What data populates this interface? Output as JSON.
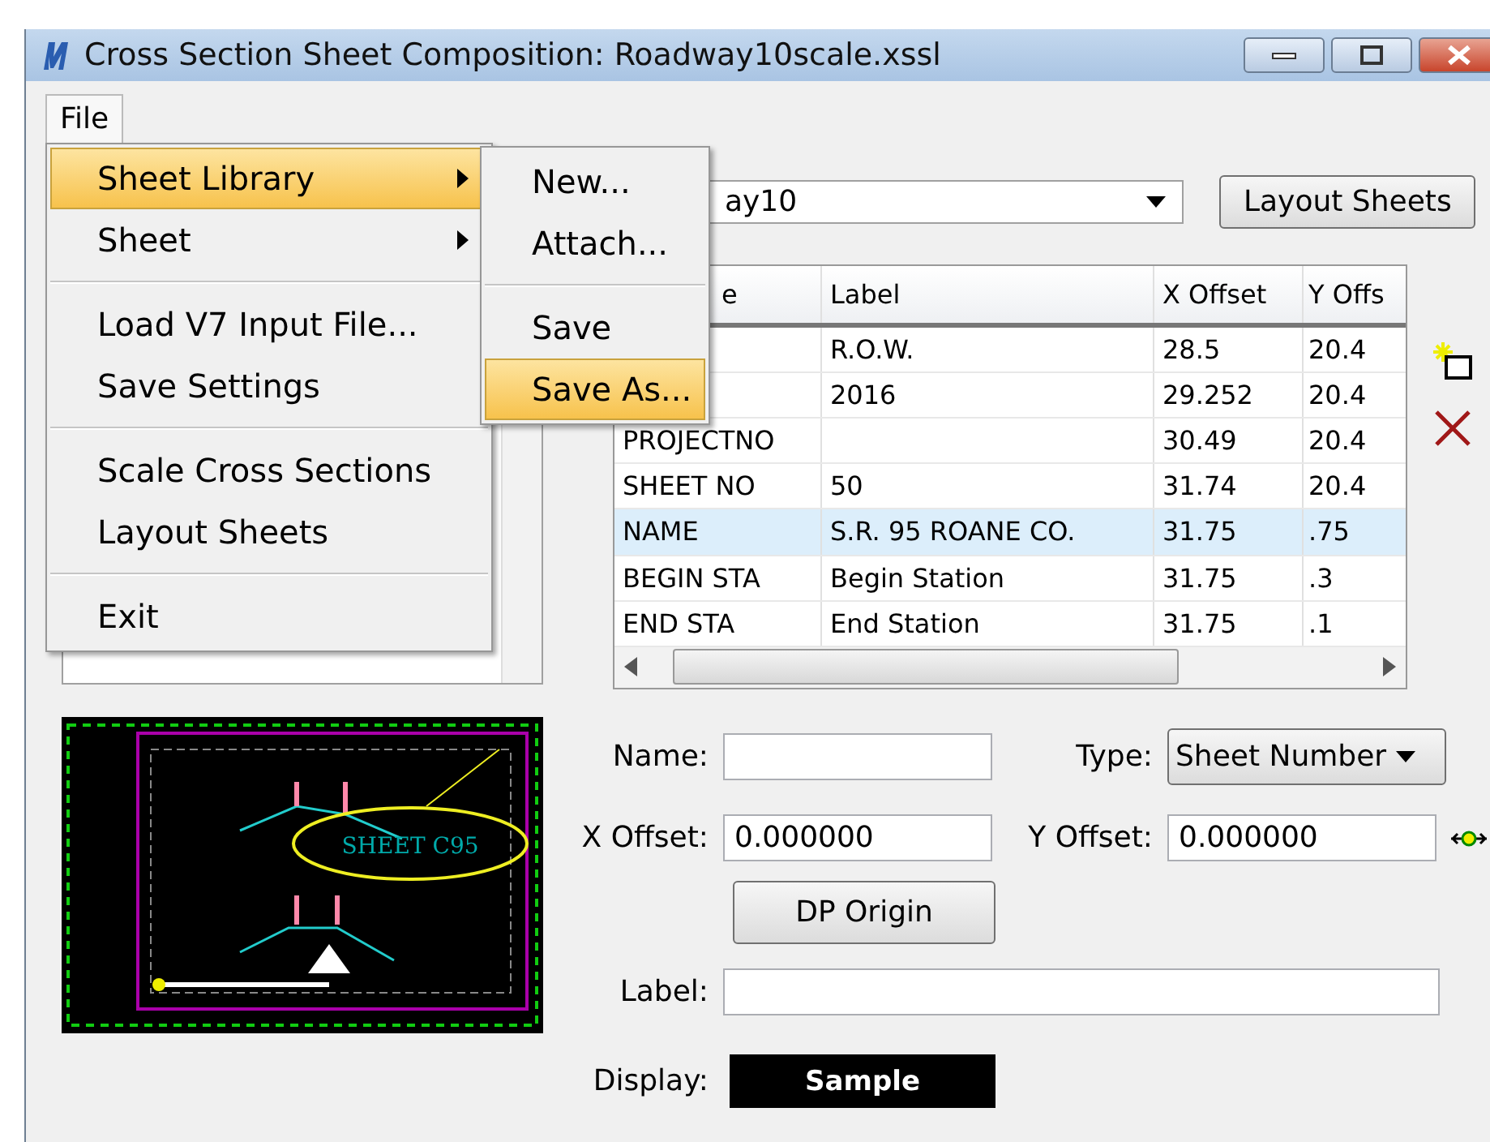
{
  "window": {
    "title": "Cross Section Sheet Composition: Roadway10scale.xssl"
  },
  "menu_bar": [
    {
      "label": "File",
      "open": true
    }
  ],
  "file_menu": [
    {
      "kind": "item",
      "label": "Sheet Library",
      "submenu": true,
      "selected": true
    },
    {
      "kind": "item",
      "label": "Sheet",
      "submenu": true,
      "selected": false
    },
    {
      "kind": "separator"
    },
    {
      "kind": "item",
      "label": "Load V7 Input File...",
      "submenu": false,
      "selected": false
    },
    {
      "kind": "item",
      "label": "Save Settings",
      "submenu": false,
      "selected": false
    },
    {
      "kind": "separator"
    },
    {
      "kind": "item",
      "label": "Scale Cross Sections",
      "submenu": false,
      "selected": false
    },
    {
      "kind": "item",
      "label": "Layout Sheets",
      "submenu": false,
      "selected": false
    },
    {
      "kind": "separator"
    },
    {
      "kind": "item",
      "label": "Exit",
      "submenu": false,
      "selected": false
    }
  ],
  "submenu": [
    {
      "kind": "item",
      "label": "New...",
      "selected": false
    },
    {
      "kind": "item",
      "label": "Attach...",
      "selected": false
    },
    {
      "kind": "separator"
    },
    {
      "kind": "item",
      "label": "Save",
      "selected": false
    },
    {
      "kind": "item",
      "label": "Save As...",
      "selected": true
    }
  ],
  "library_combo": {
    "value": "ay10"
  },
  "layout_button": "Layout Sheets",
  "table": {
    "columns": [
      "e",
      "Label",
      "X Offset",
      "Y Offs"
    ],
    "rows": [
      {
        "cells": [
          "",
          "R.O.W.",
          "28.5",
          "20.4"
        ],
        "selected": false
      },
      {
        "cells": [
          "",
          "2016",
          "29.252",
          "20.4"
        ],
        "selected": false
      },
      {
        "cells": [
          "PROJECTNO",
          "",
          "30.49",
          "20.4"
        ],
        "selected": false
      },
      {
        "cells": [
          "SHEET NO",
          "50",
          "31.74",
          "20.4"
        ],
        "selected": false
      },
      {
        "cells": [
          "NAME",
          "S.R. 95 ROANE CO.",
          "31.75",
          ".75"
        ],
        "selected": true
      },
      {
        "cells": [
          "BEGIN STA",
          "Begin Station",
          "31.75",
          ".3"
        ],
        "selected": false
      },
      {
        "cells": [
          "END STA",
          "End Station",
          "31.75",
          ".1"
        ],
        "selected": false
      }
    ]
  },
  "preview": {
    "text": "SHEET C95"
  },
  "form": {
    "name": {
      "label": "Name:"
    },
    "type": {
      "label": "Type:",
      "value": "Sheet Number"
    },
    "x_offset": {
      "label": "X Offset:",
      "value": "0.000000"
    },
    "y_offset": {
      "label": "Y Offset:",
      "value": "0.000000"
    },
    "dp_button": "DP Origin",
    "label_field": {
      "label": "Label:"
    },
    "display": {
      "label": "Display:",
      "sample": "Sample"
    }
  }
}
